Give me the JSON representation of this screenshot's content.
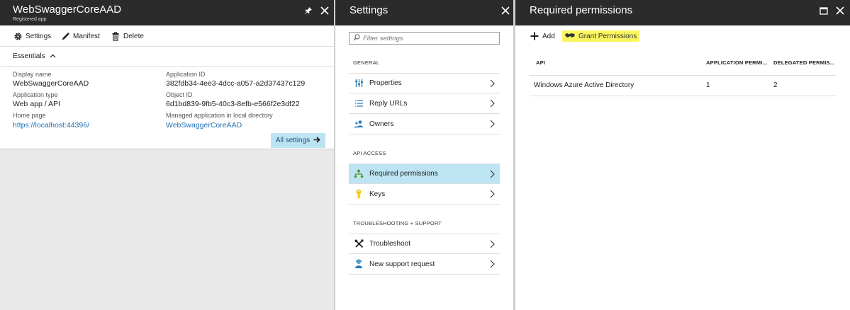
{
  "app_blade": {
    "title": "WebSwaggerCoreAAD",
    "subtitle": "Registered app",
    "toolbar": {
      "settings": "Settings",
      "manifest": "Manifest",
      "delete": "Delete"
    },
    "essentials_label": "Essentials",
    "fields": {
      "display_name_label": "Display name",
      "display_name": "WebSwaggerCoreAAD",
      "app_type_label": "Application type",
      "app_type": "Web app / API",
      "home_page_label": "Home page",
      "home_page": "https://localhost:44396/",
      "app_id_label": "Application ID",
      "app_id": "382fdb34-4ee3-4dcc-a057-a2d37437c129",
      "object_id_label": "Object ID",
      "object_id": "6d1bd839-9fb5-40c3-8efb-e566f2e3df22",
      "managed_label": "Managed application in local directory",
      "managed_value": "WebSwaggerCoreAAD"
    },
    "all_settings": "All settings"
  },
  "settings_blade": {
    "title": "Settings",
    "filter_placeholder": "Filter settings",
    "sections": {
      "general": "GENERAL",
      "api_access": "API ACCESS",
      "troubleshooting": "TROUBLESHOOTING + SUPPORT"
    },
    "items": {
      "properties": "Properties",
      "reply_urls": "Reply URLs",
      "owners": "Owners",
      "required_permissions": "Required permissions",
      "keys": "Keys",
      "troubleshoot": "Troubleshoot",
      "new_support_request": "New support request"
    }
  },
  "perm_blade": {
    "title": "Required permissions",
    "add": "Add",
    "grant": "Grant Permissions",
    "columns": {
      "api": "API",
      "app": "APPLICATION PERMI...",
      "delegated": "DELEGATED PERMIS..."
    },
    "rows": [
      {
        "api": "Windows Azure Active Directory",
        "app": "1",
        "delegated": "2"
      }
    ]
  },
  "colors": {
    "header_bg": "#2b2b2b",
    "selected_bg": "#bde4f3",
    "highlight": "#fbf65f",
    "link": "#1e6fb5"
  }
}
